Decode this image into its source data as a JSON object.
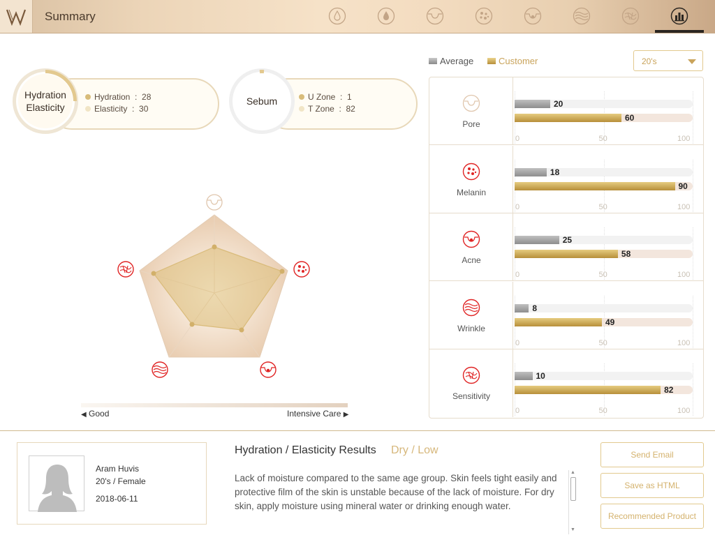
{
  "header": {
    "title": "Summary"
  },
  "stats": {
    "hydration": {
      "circle_label": "Hydration Elasticity",
      "rows": [
        {
          "label": "Hydration",
          "value": "28"
        },
        {
          "label": "Elasticity",
          "value": "30"
        }
      ]
    },
    "sebum": {
      "circle_label": "Sebum",
      "rows": [
        {
          "label": "U Zone",
          "value": "1"
        },
        {
          "label": "T Zone",
          "value": "82"
        }
      ]
    }
  },
  "legend": {
    "average": "Average",
    "customer": "Customer"
  },
  "age_select": {
    "selected": "20's"
  },
  "colors": {
    "accent_gold": "#c9a35a",
    "average_gray": "#9a9a9a",
    "icon_red": "#e02424"
  },
  "chart_data": {
    "type": "bar",
    "categories": [
      "Pore",
      "Melanin",
      "Acne",
      "Wrinkle",
      "Sensitivity"
    ],
    "series": [
      {
        "name": "Average",
        "values": [
          20,
          18,
          25,
          8,
          10
        ]
      },
      {
        "name": "Customer",
        "values": [
          60,
          90,
          58,
          49,
          82
        ]
      }
    ],
    "xlim": [
      0,
      100
    ],
    "ticks": [
      "0",
      "50",
      "100"
    ]
  },
  "radar": {
    "scale_left": "Good",
    "scale_right": "Intensive Care"
  },
  "profile": {
    "name": "Aram Huvis",
    "age_gender": "20's / Female",
    "date": "2018-06-11"
  },
  "result": {
    "title": "Hydration / Elasticity Results",
    "tag": "Dry / Low",
    "body": "Lack of moisture compared to the same age group. Skin feels tight easily and protective film of the skin is unstable because of the lack of moisture. For dry skin, apply moisture using mineral water or drinking enough water."
  },
  "buttons": {
    "send_email": "Send Email",
    "save_html": "Save as HTML",
    "recommended": "Recommended Product"
  }
}
